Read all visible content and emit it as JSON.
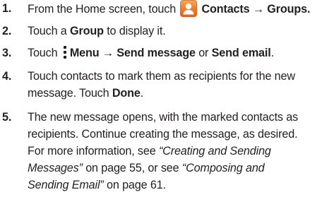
{
  "steps": [
    {
      "number": "1.",
      "text_before": "From the Home screen, touch",
      "icon": "contacts-app-icon",
      "bold_a": "Contacts",
      "arrow": "→",
      "bold_b": "Groups",
      "text_after": "."
    },
    {
      "number": "2.",
      "text_a": "Touch a",
      "bold": "Group",
      "text_b": "to display it."
    },
    {
      "number": "3.",
      "text_a": "Touch",
      "icon": "menu-icon",
      "bold_a": "Menu",
      "arrow": "→",
      "bold_b": "Send message",
      "text_or": "or",
      "bold_c": "Send email",
      "text_end": "."
    },
    {
      "number": "4.",
      "line1": "Touch contacts to mark them as recipients for the new",
      "line2_a": "message. Touch",
      "line2_bold": "Done",
      "line2_end": "."
    },
    {
      "number": "5.",
      "line1": "The new message opens, with the marked contacts as",
      "line2": "recipients. Continue creating the message, as desired.",
      "line3_a": "For more information, see",
      "line3_ital": "“Creating and Sending",
      "line4_ital": "Messages”",
      "line4_b": "on page 55, or see",
      "line4_ital2": "“Composing and",
      "line5_ital": "Sending Email”",
      "line5_b": "on page 61."
    }
  ]
}
